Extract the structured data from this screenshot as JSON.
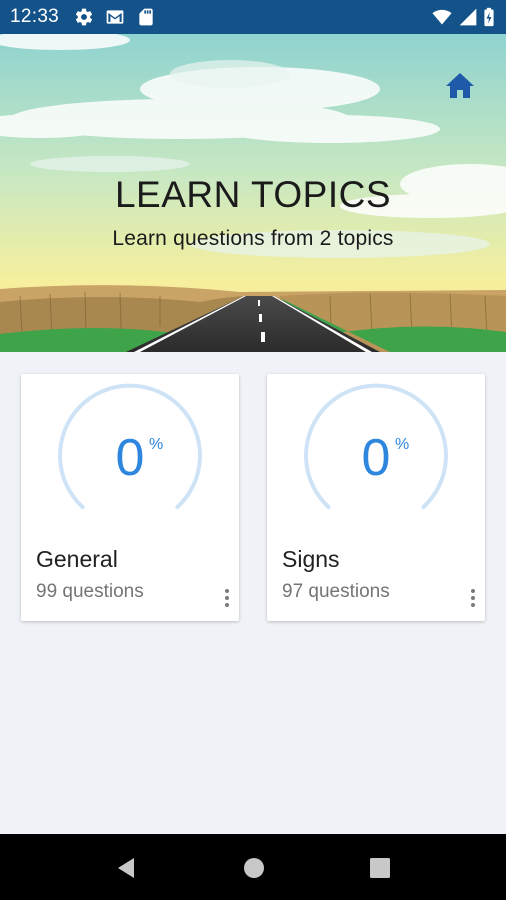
{
  "status_bar": {
    "time": "12:33",
    "icons_left": [
      "gear-icon",
      "gmail-icon",
      "sd-card-icon"
    ],
    "icons_right": [
      "wifi-icon",
      "battery-icon"
    ]
  },
  "header": {
    "title": "LEARN TOPICS",
    "subtitle": "Learn questions from 2 topics",
    "home_icon": "home-icon"
  },
  "topics": [
    {
      "name": "General",
      "progress_value": "0",
      "progress_unit": "%",
      "progress_fraction": 0,
      "question_count": "99 questions"
    },
    {
      "name": "Signs",
      "progress_value": "0",
      "progress_unit": "%",
      "progress_fraction": 0,
      "question_count": "97 questions"
    }
  ],
  "nav_bar": {
    "buttons": [
      "back-icon",
      "home-circle-icon",
      "recents-icon"
    ]
  },
  "colors": {
    "status_bar": "#13538a",
    "accent": "#2f86df",
    "gauge_track": "#cfe3f7",
    "home_icon": "#1e5aa8",
    "background": "#eff2f6"
  }
}
